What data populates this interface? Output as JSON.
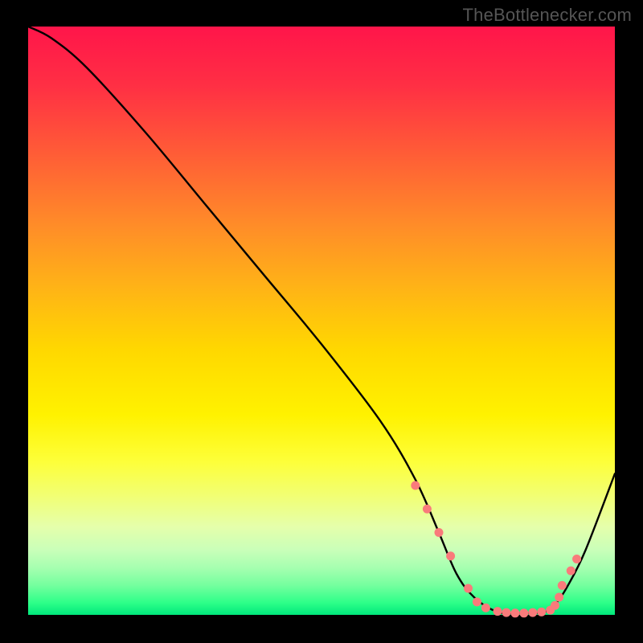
{
  "attribution": "TheBottlenecker.com",
  "chart_data": {
    "type": "line",
    "title": "",
    "xlabel": "",
    "ylabel": "",
    "xlim": [
      0,
      100
    ],
    "ylim": [
      0,
      100
    ],
    "series": [
      {
        "name": "bottleneck-curve",
        "x": [
          0,
          4,
          10,
          20,
          30,
          40,
          50,
          60,
          66,
          70,
          73,
          76,
          80,
          84,
          88,
          90,
          92,
          95,
          100
        ],
        "y": [
          100,
          98,
          93,
          82,
          70,
          58,
          46,
          33,
          23,
          14,
          7,
          3,
          0.5,
          0.3,
          0.5,
          2,
          5,
          11,
          24
        ]
      }
    ],
    "markers": {
      "name": "highlighted-points",
      "x": [
        66,
        68,
        70,
        72,
        75,
        76.5,
        78,
        80,
        81.5,
        83,
        84.5,
        86,
        87.5,
        89,
        89.8,
        90.5,
        91,
        92.5,
        93.5
      ],
      "y": [
        22,
        18,
        14,
        10,
        4.5,
        2.2,
        1.2,
        0.6,
        0.4,
        0.3,
        0.3,
        0.4,
        0.5,
        0.8,
        1.6,
        3.0,
        5.0,
        7.5,
        9.5
      ]
    },
    "gradient_stops": [
      {
        "pos": 0,
        "color": "#ff154a"
      },
      {
        "pos": 10,
        "color": "#ff2f44"
      },
      {
        "pos": 22,
        "color": "#ff5e36"
      },
      {
        "pos": 34,
        "color": "#ff8d28"
      },
      {
        "pos": 44,
        "color": "#ffb217"
      },
      {
        "pos": 55,
        "color": "#ffd800"
      },
      {
        "pos": 66,
        "color": "#fff200"
      },
      {
        "pos": 74,
        "color": "#fdff3a"
      },
      {
        "pos": 80,
        "color": "#f1ff76"
      },
      {
        "pos": 85,
        "color": "#e5ffab"
      },
      {
        "pos": 89,
        "color": "#c9ffb9"
      },
      {
        "pos": 92,
        "color": "#a6ffb0"
      },
      {
        "pos": 95,
        "color": "#74ff9e"
      },
      {
        "pos": 98,
        "color": "#2cff88"
      },
      {
        "pos": 100,
        "color": "#00e87c"
      }
    ],
    "marker_color": "#f97b7b",
    "line_color": "#000000"
  }
}
